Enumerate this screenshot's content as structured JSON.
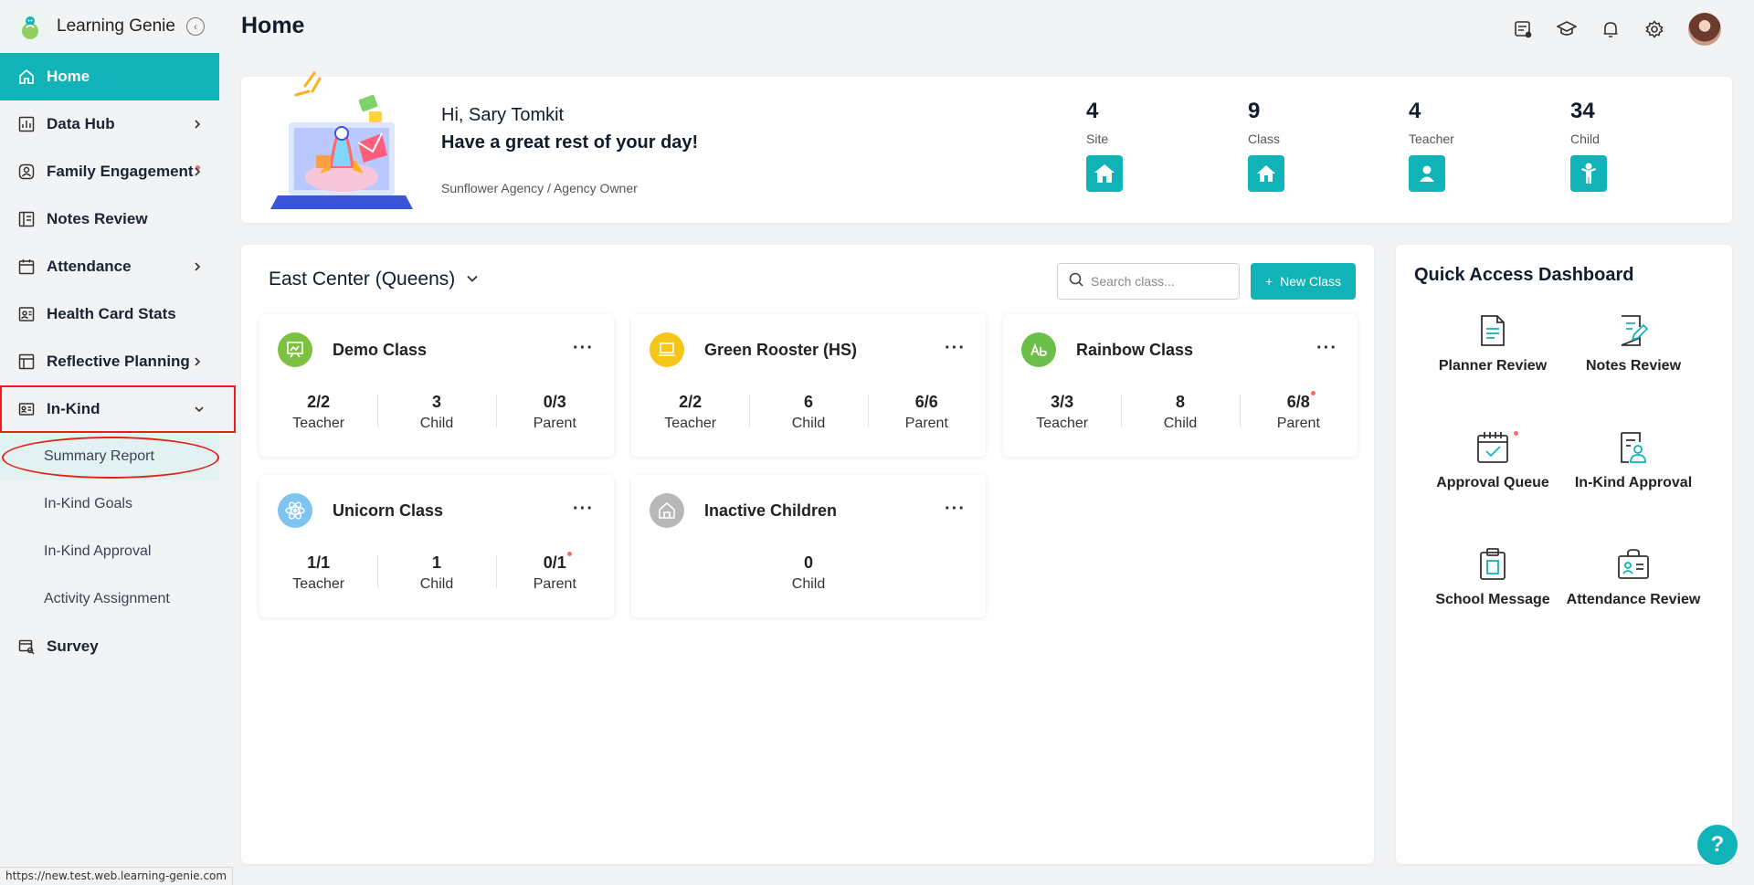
{
  "app": {
    "name": "Learning Genie",
    "collapse_icon": "chevron-left-circle-icon",
    "accent_color": "#10b3b7"
  },
  "sidebar": {
    "items": [
      {
        "label": "Home",
        "icon": "home-icon",
        "active": true
      },
      {
        "label": "Data Hub",
        "icon": "bar-chart-icon",
        "has_children": true
      },
      {
        "label": "Family Engagement",
        "icon": "family-icon",
        "has_children": true,
        "badge_dot": true
      },
      {
        "label": "Notes Review",
        "icon": "notes-icon"
      },
      {
        "label": "Attendance",
        "icon": "calendar-icon",
        "has_children": true
      },
      {
        "label": "Health Card Stats",
        "icon": "health-card-icon"
      },
      {
        "label": "Reflective Planning",
        "icon": "planning-icon",
        "has_children": true
      },
      {
        "label": "In-Kind",
        "icon": "in-kind-icon",
        "expanded": true
      },
      {
        "label": "Survey",
        "icon": "survey-icon"
      }
    ],
    "in_kind_children": [
      {
        "label": "Summary Report",
        "selected": true
      },
      {
        "label": "In-Kind Goals"
      },
      {
        "label": "In-Kind Approval"
      },
      {
        "label": "Activity Assignment"
      }
    ]
  },
  "status_bar": {
    "url": "https://new.test.web.learning-genie.com"
  },
  "header": {
    "title": "Home",
    "icons": [
      "message-list-icon",
      "graduation-cap-icon",
      "bell-icon",
      "gear-icon",
      "avatar"
    ]
  },
  "welcome": {
    "greeting": "Hi, Sary Tomkit",
    "message": "Have a great rest of your day!",
    "org": "Sunflower Agency / Agency Owner",
    "stats": [
      {
        "value": "4",
        "label": "Site",
        "icon": "site-home-icon"
      },
      {
        "value": "9",
        "label": "Class",
        "icon": "class-home-icon"
      },
      {
        "value": "4",
        "label": "Teacher",
        "icon": "teacher-person-icon"
      },
      {
        "value": "34",
        "label": "Child",
        "icon": "child-icon"
      }
    ]
  },
  "classes_panel": {
    "center": "East Center (Queens)",
    "search_placeholder": "Search class...",
    "new_class_label": "New Class",
    "more_glyph": "···",
    "classes": [
      {
        "name": "Demo Class",
        "icon_color": "#7dc142",
        "stats": [
          {
            "value": "2/2",
            "label": "Teacher"
          },
          {
            "value": "3",
            "label": "Child"
          },
          {
            "value": "0/3",
            "label": "Parent"
          }
        ]
      },
      {
        "name": "Green Rooster (HS)",
        "icon_color": "#f5c518",
        "stats": [
          {
            "value": "2/2",
            "label": "Teacher"
          },
          {
            "value": "6",
            "label": "Child"
          },
          {
            "value": "6/6",
            "label": "Parent"
          }
        ]
      },
      {
        "name": "Rainbow Class",
        "icon_color": "#6cc04a",
        "stats": [
          {
            "value": "3/3",
            "label": "Teacher"
          },
          {
            "value": "8",
            "label": "Child"
          },
          {
            "value": "6/8",
            "label": "Parent",
            "dot": true
          }
        ]
      },
      {
        "name": "Unicorn Class",
        "icon_color": "#7fc4f0",
        "stats": [
          {
            "value": "1/1",
            "label": "Teacher"
          },
          {
            "value": "1",
            "label": "Child"
          },
          {
            "value": "0/1",
            "label": "Parent",
            "dot": true
          }
        ]
      },
      {
        "name": "Inactive Children",
        "icon_color": "#b8b8b8",
        "stats": [
          {
            "value": "0",
            "label": "Child"
          }
        ]
      }
    ]
  },
  "quick_access": {
    "title": "Quick Access Dashboard",
    "items": [
      {
        "label": "Planner Review",
        "icon": "planner-doc-icon"
      },
      {
        "label": "Notes Review",
        "icon": "notes-edit-icon"
      },
      {
        "label": "Approval Queue",
        "icon": "calendar-check-icon",
        "dot": true
      },
      {
        "label": "In-Kind Approval",
        "icon": "in-kind-doc-icon"
      },
      {
        "label": "School Message",
        "icon": "clipboard-icon"
      },
      {
        "label": "Attendance Review",
        "icon": "id-card-icon"
      }
    ]
  },
  "help": {
    "label": "?"
  }
}
